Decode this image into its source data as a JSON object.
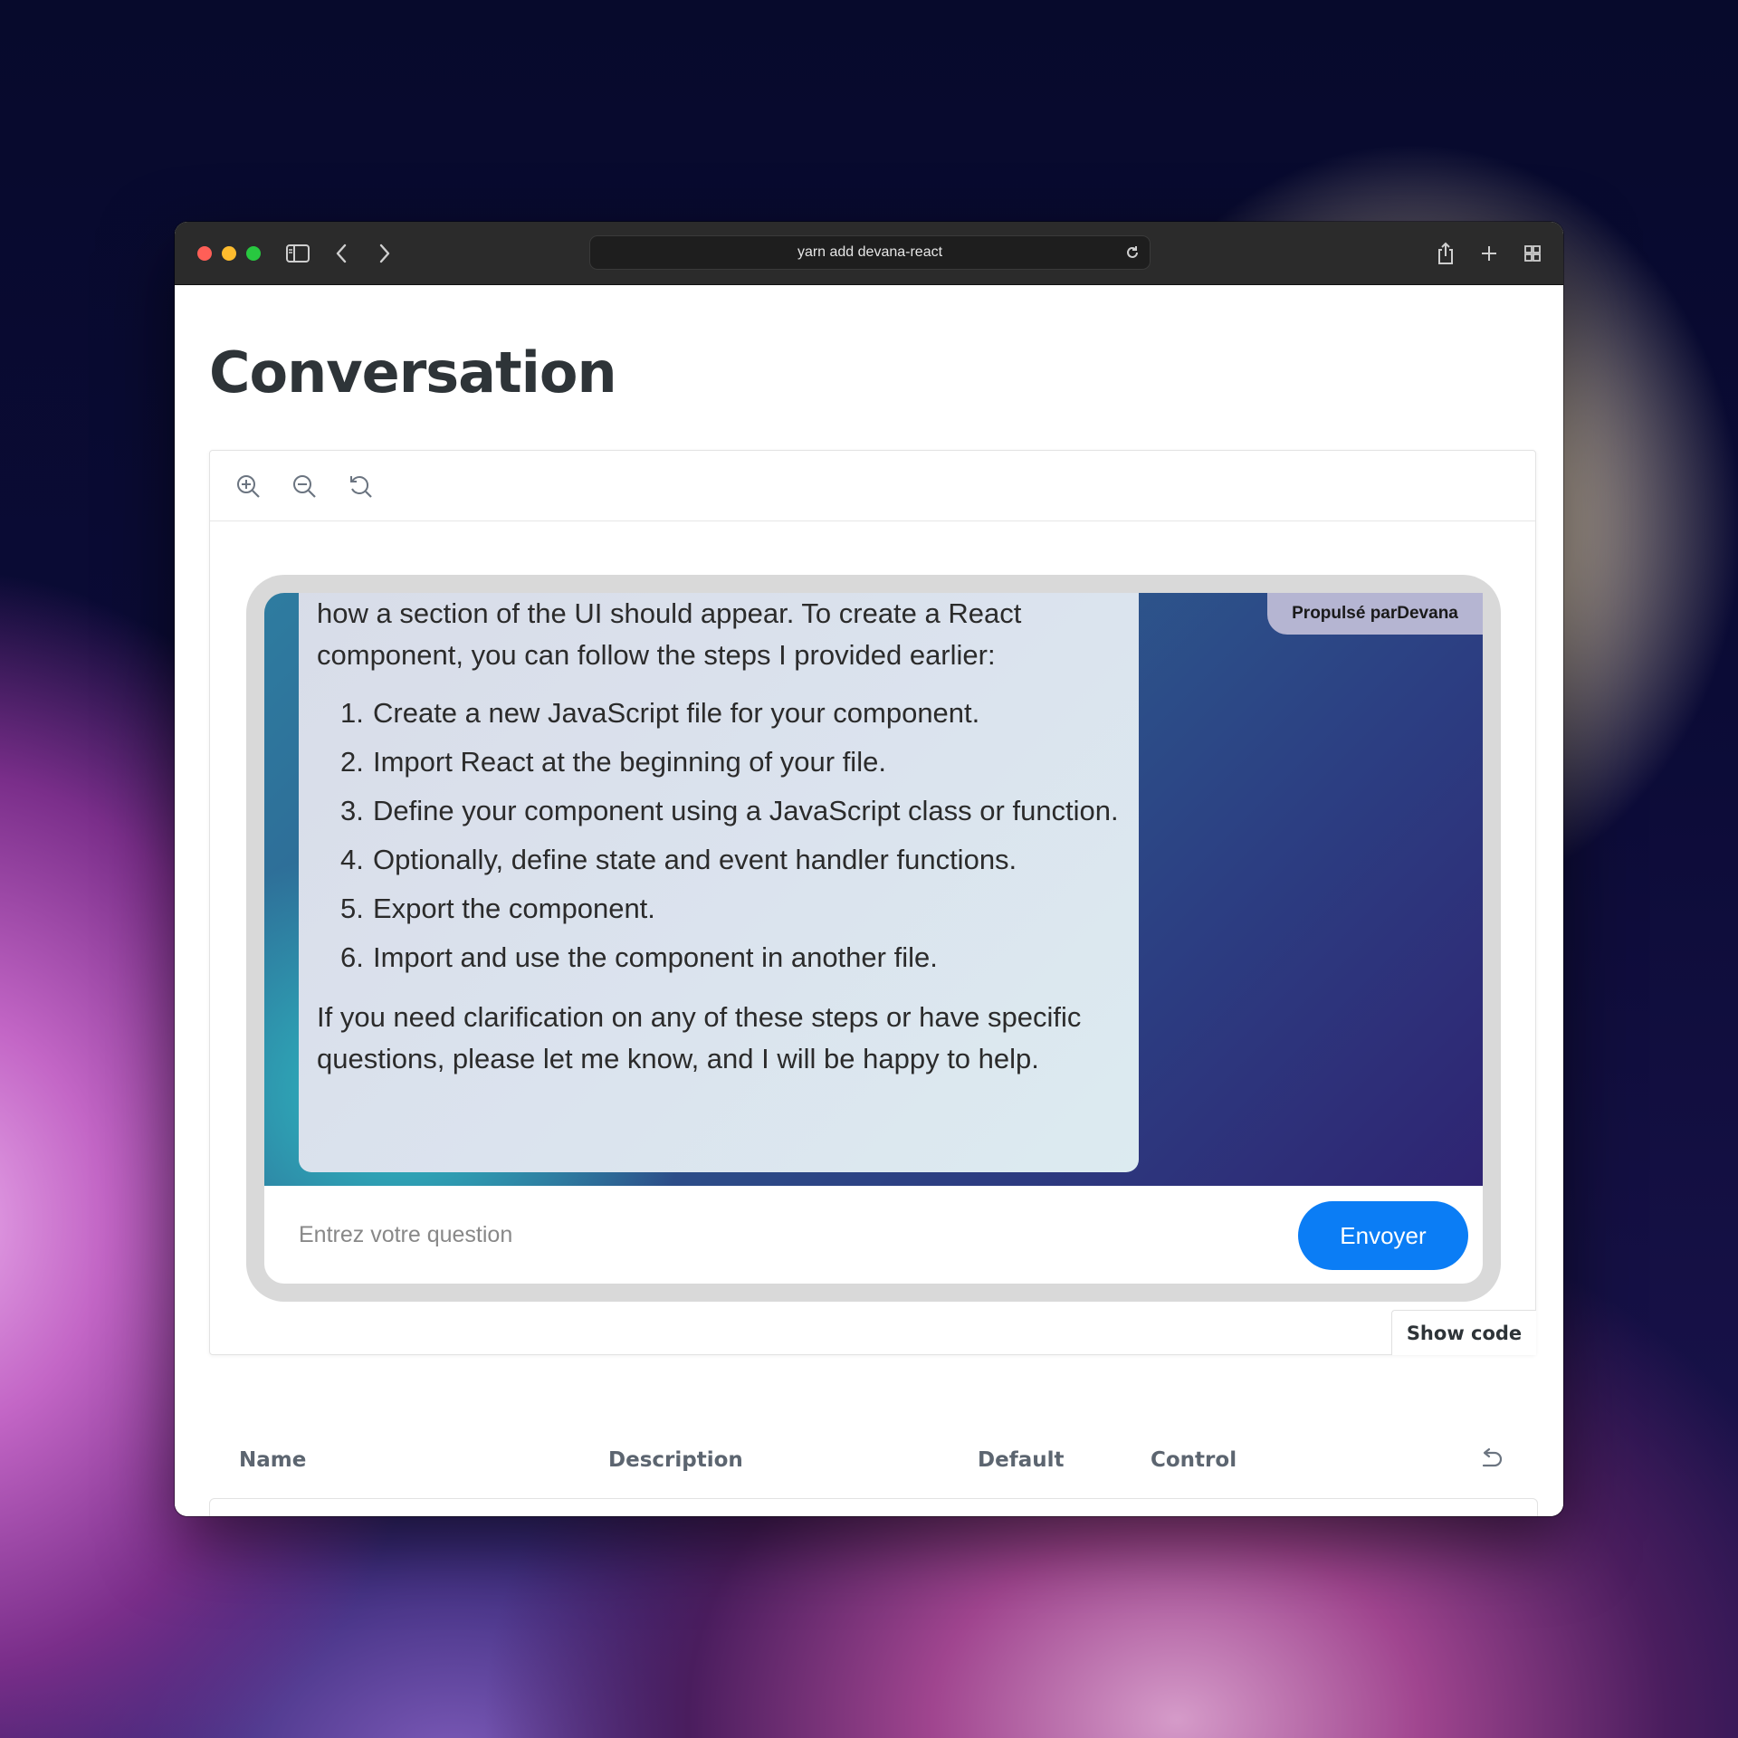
{
  "browser": {
    "address": "yarn add devana-react"
  },
  "page": {
    "title": "Conversation"
  },
  "chat": {
    "message_lead": "how a section of the UI should appear. To create a React component, you can follow the steps I provided earlier:",
    "steps": [
      {
        "num": "1.",
        "text": "Create a new JavaScript file for your component."
      },
      {
        "num": "2.",
        "text": "Import React at the beginning of your file."
      },
      {
        "num": "3.",
        "text": "Define your component using a JavaScript class or function."
      },
      {
        "num": "4.",
        "text": "Optionally, define state and event handler functions."
      },
      {
        "num": "5.",
        "text": "Export the component."
      },
      {
        "num": "6.",
        "text": "Import and use the component in another file."
      }
    ],
    "message_outro": "If you need clarification on any of these steps or have specific questions, please let me know, and I will be happy to help.",
    "badge": "Propulsé parDevana",
    "input_placeholder": "Entrez votre question",
    "input_value": "",
    "send_label": "Envoyer"
  },
  "canvas": {
    "show_code_label": "Show code"
  },
  "args_table": {
    "columns": [
      "Name",
      "Description",
      "Default",
      "Control"
    ]
  },
  "colors": {
    "send_button": "#0b7df5",
    "badge": "#b5b5d2"
  }
}
